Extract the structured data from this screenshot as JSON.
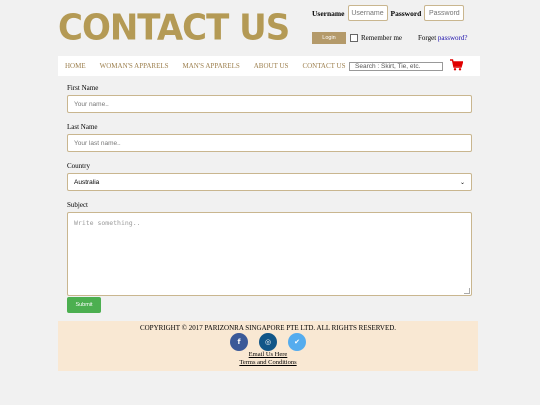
{
  "header": {
    "logo_text": "CONTACT US",
    "username_label": "Username",
    "username_placeholder": "Username",
    "password_label": "Password",
    "password_placeholder": "Password",
    "login_button": "Login",
    "remember_label": "Remember me",
    "forget_prefix": "Forget ",
    "forget_link": "password?"
  },
  "nav": {
    "items": [
      "HOME",
      "WOMAN'S APPARELS",
      "MAN'S APPARELS",
      "ABOUT US",
      "CONTACT US"
    ],
    "search_placeholder": "Search : Skirt, Tie, etc.",
    "cart_icon": "shopping-cart-icon",
    "cart_color": "#e00000"
  },
  "form": {
    "first_name_label": "First Name",
    "first_name_placeholder": "Your name..",
    "last_name_label": "Last Name",
    "last_name_placeholder": "Your last name..",
    "country_label": "Country",
    "country_value": "Australia",
    "subject_label": "Subject",
    "subject_placeholder": "Write something..",
    "submit_label": "Submit"
  },
  "footer": {
    "copyright": "COPYRIGHT © 2017 PARIZONRA SINGAPORE PTE LTD. ALL RIGHTS RESERVED.",
    "socials": [
      {
        "name": "facebook",
        "glyph": "f",
        "color": "#3b5998"
      },
      {
        "name": "instagram",
        "glyph": "◎",
        "color": "#125688"
      },
      {
        "name": "twitter",
        "glyph": "✔",
        "color": "#55acee"
      }
    ],
    "email_link": "Email Us Here",
    "terms_link": "Terms and Conditions"
  }
}
